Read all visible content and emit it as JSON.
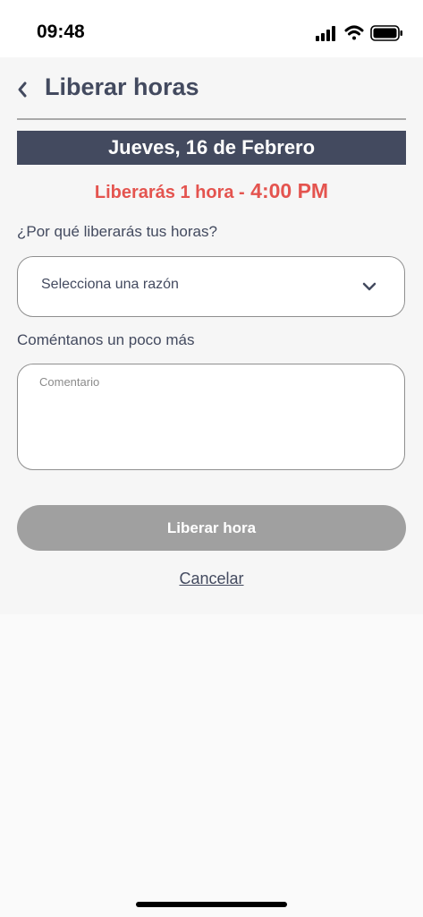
{
  "status_bar": {
    "time": "09:48",
    "icons": [
      "signal-icon",
      "wifi-icon",
      "battery-icon"
    ]
  },
  "header": {
    "back_icon": "chevron-left-icon",
    "title": "Liberar horas"
  },
  "date_banner": {
    "text": "Jueves, 16 de Febrero"
  },
  "release_info": {
    "label": "Liberarás 1 hora -",
    "time": "4:00 PM",
    "color": "#e4544f"
  },
  "reason": {
    "label": "¿Por qué liberarás tus horas?",
    "placeholder": "Selecciona una razón",
    "icon": "chevron-down-icon"
  },
  "comment": {
    "label": "Coméntanos un poco más",
    "placeholder": "Comentario",
    "value": ""
  },
  "actions": {
    "submit_label": "Liberar hora",
    "cancel_label": "Cancelar"
  },
  "colors": {
    "primary": "#434a5f",
    "accent": "#e4544f",
    "disabled_button": "#a0a0a0"
  }
}
